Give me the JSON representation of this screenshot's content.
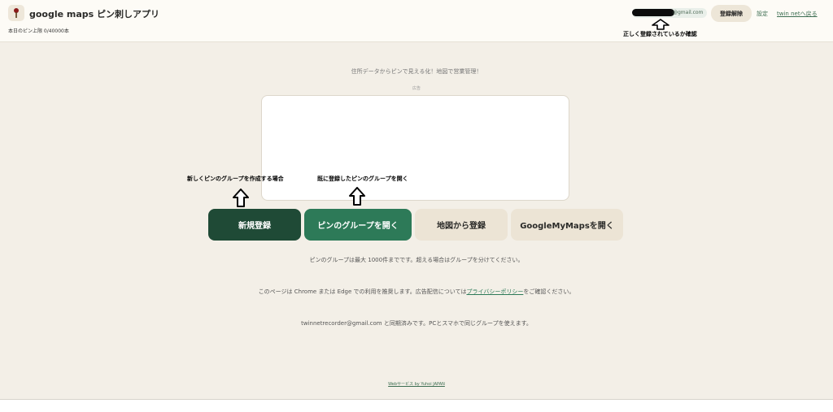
{
  "header": {
    "app_title": "google maps ピン刺しアプリ",
    "quota": "本日のピン上限 0/40000本",
    "email_domain": "@gmail.com",
    "unregister_label": "登録解除",
    "settings_label": "設定",
    "back_label": "twin netへ戻る"
  },
  "annotations": {
    "account_check": "正しく登録されているか確認",
    "new_group": "新しくピンのグループを作成する場合",
    "open_group": "既に登録したピンのグループを開く"
  },
  "main": {
    "tagline": "住所データからピンで見える化！地図で営業管理！",
    "ad_label": "広告",
    "buttons": {
      "new": "新規登録",
      "open": "ピンのグループを開く",
      "map": "地図から登録",
      "gmm": "GoogleMyMapsを開く"
    },
    "info_limit": "ピンのグループは最大 1000件までです。超える場合はグループを分けてください。",
    "info_browser_before": "このページは Chrome または Edge での利用を推奨します。広告配信については",
    "info_privacy_link": "プライバシーポリシー",
    "info_browser_after": "をご確認ください。",
    "info_sync": "twinnetrecorder@gmail.com と同期済みです。PCとスマホで同じグループを使えます。",
    "footer": "Webサービス by Yuhoi JAPAN"
  },
  "icons": {
    "app_icon": "pin-icon",
    "arrow": "arrow-up-icon"
  },
  "colors": {
    "primary_dark": "#1f4a36",
    "primary": "#2d7a58",
    "background": "#f3efe7",
    "secondary_button": "#ece4d5"
  }
}
